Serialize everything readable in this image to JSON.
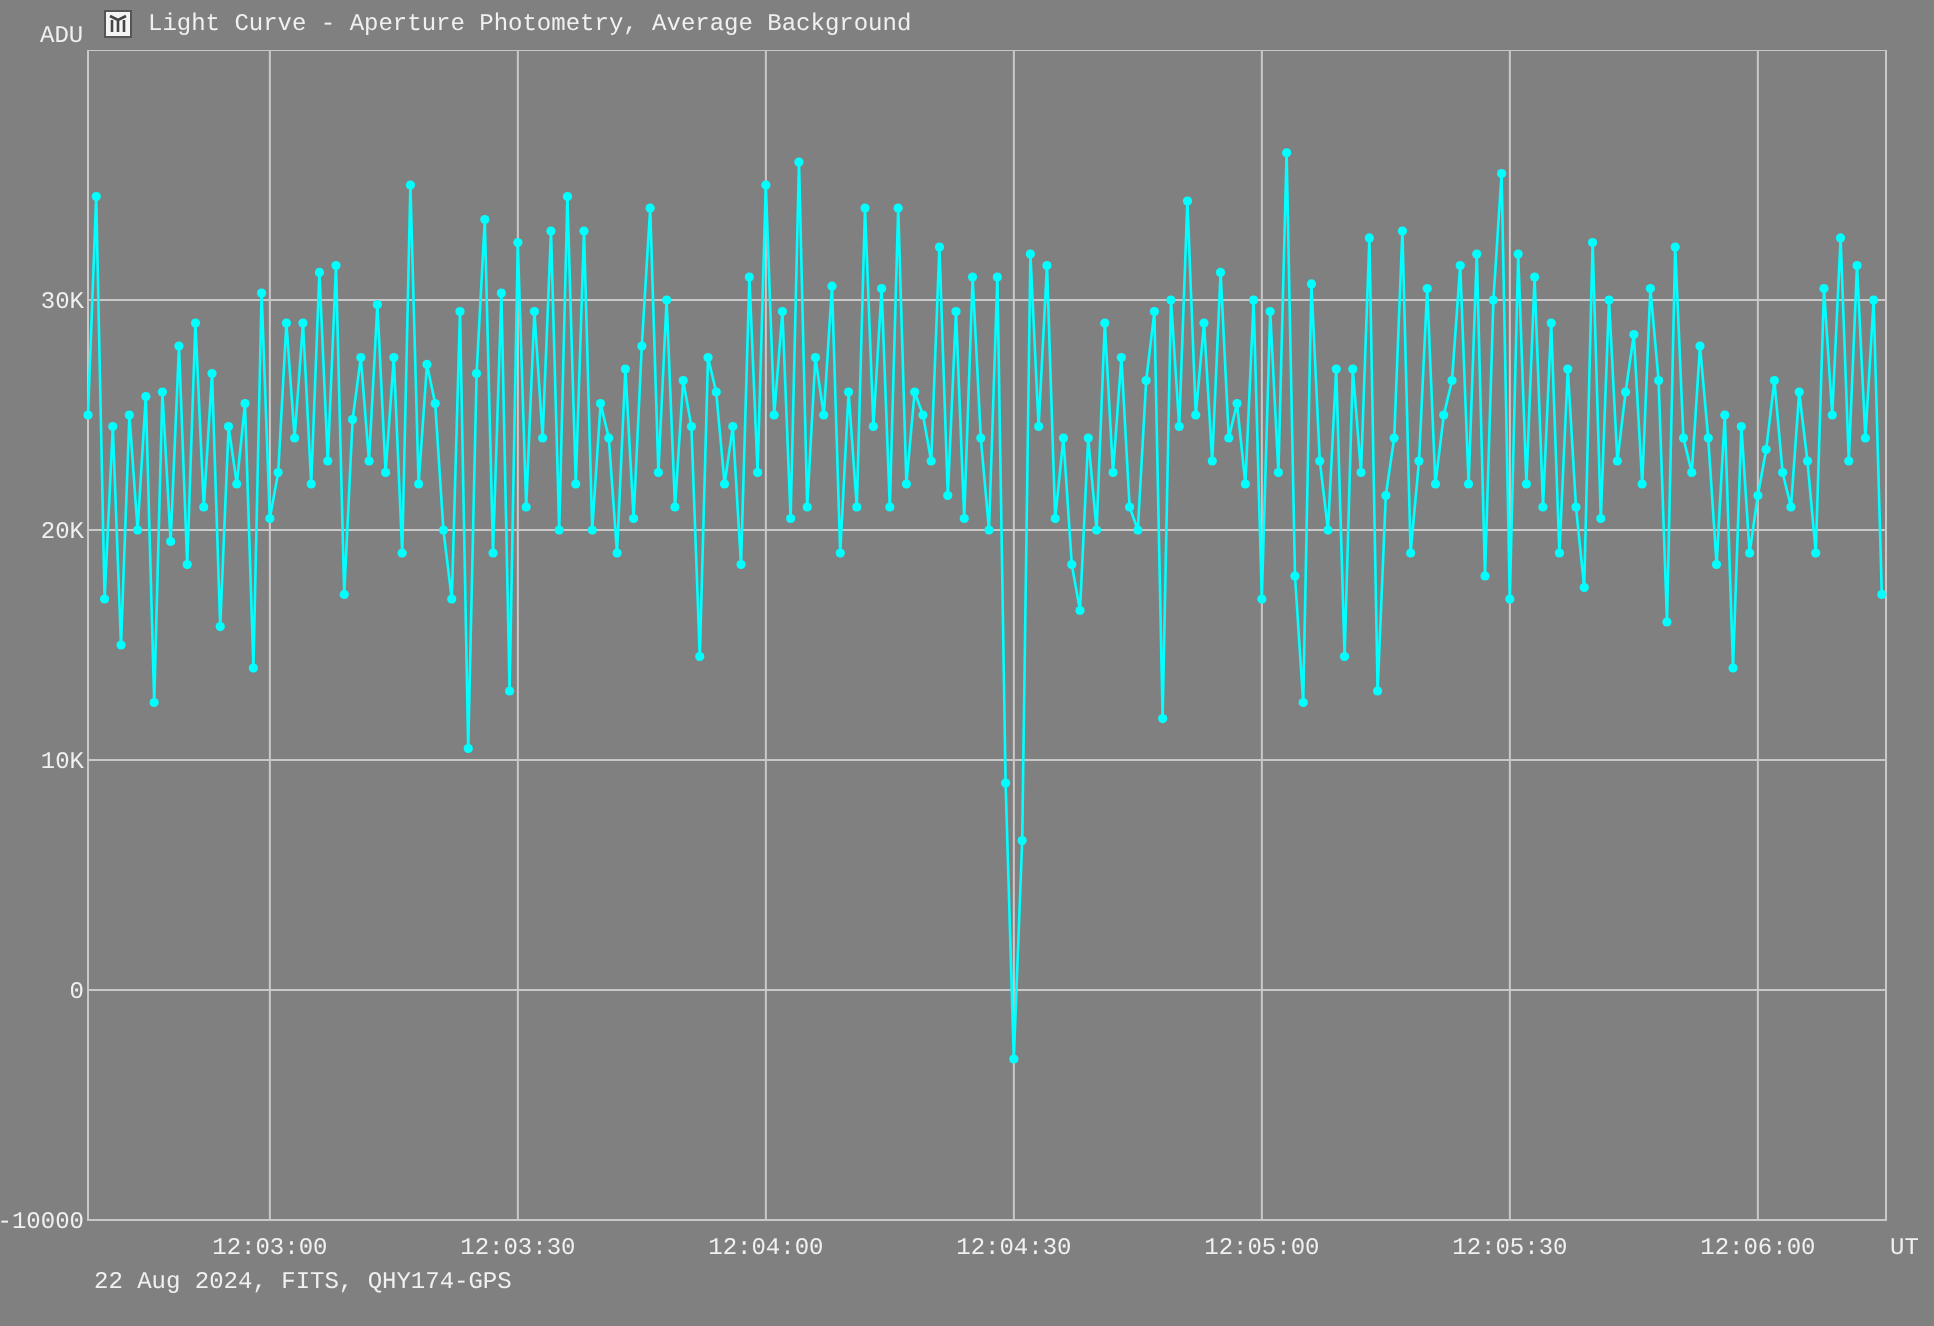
{
  "window": {
    "title": "Light Curve - Aperture Photometry, Average Background"
  },
  "plot": {
    "chart_data": {
      "type": "line",
      "xlabel": "UT",
      "ylabel": "ADU",
      "x": [
        43358,
        43359,
        43360,
        43361,
        43362,
        43363,
        43364,
        43365,
        43366,
        43367,
        43368,
        43369,
        43370,
        43371,
        43372,
        43373,
        43374,
        43375,
        43376,
        43377,
        43378,
        43379,
        43380,
        43381,
        43382,
        43383,
        43384,
        43385,
        43386,
        43387,
        43388,
        43389,
        43390,
        43391,
        43392,
        43393,
        43394,
        43395,
        43396,
        43397,
        43398,
        43399,
        43400,
        43401,
        43402,
        43403,
        43404,
        43405,
        43406,
        43407,
        43408,
        43409,
        43410,
        43411,
        43412,
        43413,
        43414,
        43415,
        43416,
        43417,
        43418,
        43419,
        43420,
        43421,
        43422,
        43423,
        43424,
        43425,
        43426,
        43427,
        43428,
        43429,
        43430,
        43431,
        43432,
        43433,
        43434,
        43435,
        43436,
        43437,
        43438,
        43439,
        43440,
        43441,
        43442,
        43443,
        43444,
        43445,
        43446,
        43447,
        43448,
        43449,
        43450,
        43451,
        43452,
        43453,
        43454,
        43455,
        43456,
        43457,
        43458,
        43459,
        43460,
        43461,
        43462,
        43463,
        43464,
        43465,
        43466,
        43467,
        43468,
        43469,
        43470,
        43471,
        43472,
        43473,
        43474,
        43475,
        43476,
        43477,
        43478,
        43479,
        43480,
        43481,
        43482,
        43483,
        43484,
        43485,
        43486,
        43487,
        43488,
        43489,
        43490,
        43491,
        43492,
        43493,
        43494,
        43495,
        43496,
        43497,
        43498,
        43499,
        43500,
        43501,
        43502,
        43503,
        43504,
        43505,
        43506,
        43507,
        43508,
        43509,
        43510,
        43511,
        43512,
        43513,
        43514,
        43515,
        43516,
        43517,
        43518,
        43519,
        43520,
        43521,
        43522,
        43523,
        43524,
        43525,
        43526,
        43527,
        43528,
        43529,
        43530,
        43531,
        43532,
        43533,
        43534,
        43535,
        43536,
        43537,
        43538,
        43539,
        43540,
        43541,
        43542,
        43543,
        43544,
        43545,
        43546,
        43547,
        43548,
        43549,
        43550,
        43551,
        43552,
        43553,
        43554,
        43555,
        43556,
        43557,
        43558,
        43559,
        43560,
        43561,
        43562,
        43563,
        43564,
        43565,
        43566,
        43567,
        43568,
        43569,
        43570,
        43571,
        43572,
        43573,
        43574,
        43575
      ],
      "grid": true,
      "series": [
        {
          "color": "#00ffff",
          "marker": "circle",
          "values": [
            25000,
            34500,
            17000,
            24500,
            15000,
            25000,
            20000,
            25800,
            12500,
            26000,
            19500,
            28000,
            18500,
            29000,
            21000,
            26800,
            15800,
            24500,
            22000,
            25500,
            14000,
            30300,
            20500,
            22500,
            29000,
            24000,
            29000,
            22000,
            31200,
            23000,
            31500,
            17200,
            24800,
            27500,
            23000,
            29800,
            22500,
            27500,
            19000,
            35000,
            22000,
            27200,
            25500,
            20000,
            17000,
            29500,
            10500,
            26800,
            33500,
            19000,
            30300,
            13000,
            32500,
            21000,
            29500,
            24000,
            33000,
            20000,
            34500,
            22000,
            33000,
            20000,
            25500,
            24000,
            19000,
            27000,
            20500,
            28000,
            34000,
            22500,
            30000,
            21000,
            26500,
            24500,
            14500,
            27500,
            26000,
            22000,
            24500,
            18500,
            31000,
            22500,
            35000,
            25000,
            29500,
            20500,
            36000,
            21000,
            27500,
            25000,
            30600,
            19000,
            26000,
            21000,
            34000,
            24500,
            30500,
            21000,
            34000,
            22000,
            26000,
            25000,
            23000,
            32300,
            21500,
            29500,
            20500,
            31000,
            24000,
            20000,
            31000,
            9000,
            -3000,
            6500,
            32000,
            24500,
            31500,
            20500,
            24000,
            18500,
            16500,
            24000,
            20000,
            29000,
            22500,
            27500,
            21000,
            20000,
            26500,
            29500,
            11800,
            30000,
            24500,
            34300,
            25000,
            29000,
            23000,
            31200,
            24000,
            25500,
            22000,
            30000,
            17000,
            29500,
            22500,
            36400,
            18000,
            12500,
            30700,
            23000,
            20000,
            27000,
            14500,
            27000,
            22500,
            32700,
            13000,
            21500,
            24000,
            33000,
            19000,
            23000,
            30500,
            22000,
            25000,
            26500,
            31500,
            22000,
            32000,
            18000,
            30000,
            35500,
            17000,
            32000,
            22000,
            31000,
            21000,
            29000,
            19000,
            27000,
            21000,
            17500,
            32500,
            20500,
            30000,
            23000,
            26000,
            28500,
            22000,
            30500,
            26500,
            16000,
            32300,
            24000,
            22500,
            28000,
            24000,
            18500,
            25000,
            14000,
            24500,
            19000,
            21500,
            23500,
            26500,
            22500,
            21000,
            26000,
            23000,
            19000,
            30500,
            25000,
            32700,
            23000,
            31500,
            24000,
            30000,
            17200
          ]
        }
      ],
      "xlim": [
        43358,
        43575.5
      ],
      "ylim": [
        -10000,
        40870
      ],
      "xticks": [
        {
          "value": 43380,
          "label": "12:03:00"
        },
        {
          "value": 43410,
          "label": "12:03:30"
        },
        {
          "value": 43440,
          "label": "12:04:00"
        },
        {
          "value": 43470,
          "label": "12:04:30"
        },
        {
          "value": 43500,
          "label": "12:05:00"
        },
        {
          "value": 43530,
          "label": "12:05:30"
        },
        {
          "value": 43560,
          "label": "12:06:00"
        }
      ],
      "yticks": [
        {
          "value": -10000,
          "label": "-10000"
        },
        {
          "value": 0,
          "label": "0"
        },
        {
          "value": 10000,
          "label": "10K"
        },
        {
          "value": 20000,
          "label": "20K"
        },
        {
          "value": 30000,
          "label": "30K"
        }
      ]
    }
  },
  "footer": "22 Aug 2024, FITS, QHY174-GPS"
}
